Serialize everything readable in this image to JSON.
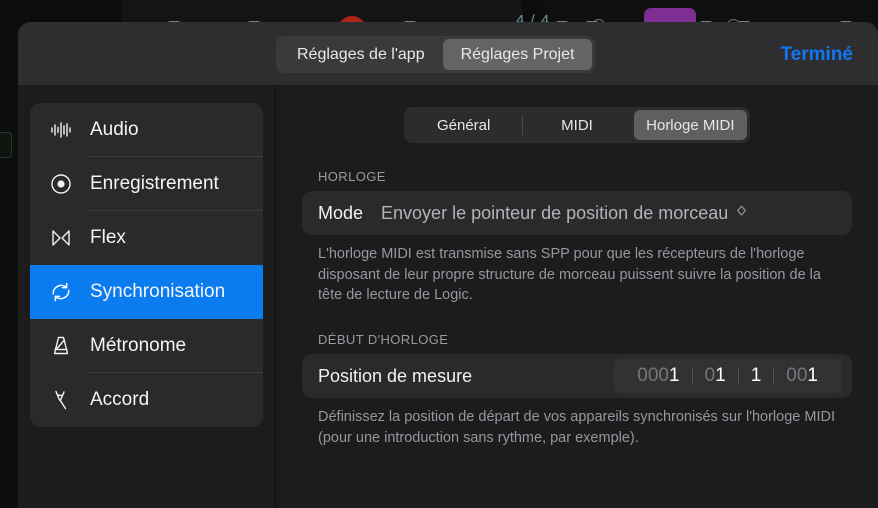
{
  "background": {
    "time_signature": "4 / 4"
  },
  "dialog": {
    "top_tabs": [
      {
        "label": "Réglages de l'app",
        "active": false,
        "name": "tab-app-settings"
      },
      {
        "label": "Réglages Projet",
        "active": true,
        "name": "tab-project-settings"
      }
    ],
    "done_label": "Terminé",
    "sidebar": [
      {
        "label": "Audio",
        "icon": "waveform-icon",
        "active": false
      },
      {
        "label": "Enregistrement",
        "icon": "record-icon",
        "active": false
      },
      {
        "label": "Flex",
        "icon": "flex-icon",
        "active": false
      },
      {
        "label": "Synchronisation",
        "icon": "sync-icon",
        "active": true
      },
      {
        "label": "Métronome",
        "icon": "metronome-icon",
        "active": false
      },
      {
        "label": "Accord",
        "icon": "tuning-fork-icon",
        "active": false
      }
    ],
    "sub_tabs": [
      {
        "label": "Général",
        "active": false,
        "name": "tab-general"
      },
      {
        "label": "MIDI",
        "active": false,
        "name": "tab-midi"
      },
      {
        "label": "Horloge MIDI",
        "active": true,
        "name": "tab-midi-clock"
      }
    ],
    "sections": {
      "clock": {
        "header": "HORLOGE",
        "mode_label": "Mode",
        "mode_value": "Envoyer le pointeur de position de morceau",
        "description": "L'horloge MIDI est transmise sans SPP pour que les récepteurs de l'horloge disposant de leur propre structure de morceau puissent suivre la position de la tête de lecture de Logic."
      },
      "clock_start": {
        "header": "DÉBUT D'HORLOGE",
        "position_label": "Position de mesure",
        "position": {
          "bar_dim": "000",
          "bar": "1",
          "beat_dim": "0",
          "beat": "1",
          "division_dim": "",
          "division": "1",
          "ticks_dim": "00",
          "ticks": "1"
        },
        "description": "Définissez la position de départ de vos appareils synchronisés sur l'horloge MIDI (pour une introduction sans rythme, par exemple)."
      }
    }
  },
  "colors": {
    "accent_blue": "#0a7cf0",
    "link_blue": "#1277f5",
    "panel": "#2a2a2c",
    "dialog_bg": "#1c1c1e",
    "titlebar": "#2e2e30"
  }
}
